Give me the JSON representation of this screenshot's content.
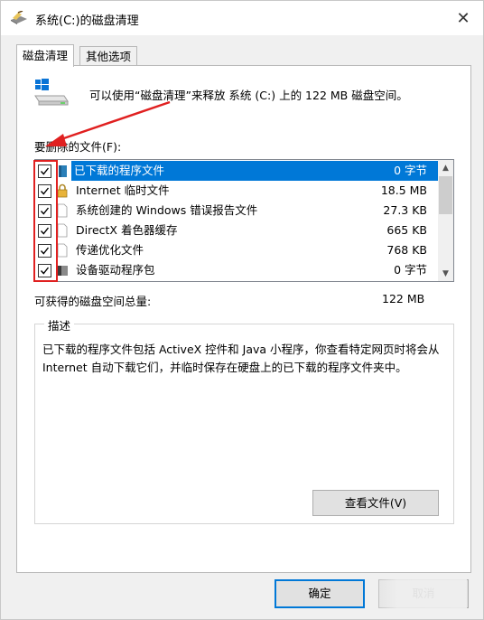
{
  "window": {
    "title": "系统(C:)的磁盘清理",
    "close": "✕"
  },
  "tabs": [
    {
      "label": "磁盘清理",
      "active": true
    },
    {
      "label": "其他选项",
      "active": false
    }
  ],
  "intro": "可以使用“磁盘清理”来释放 系统 (C:) 上的 122 MB 磁盘空间。",
  "files_label": "要删除的文件(F):",
  "files": [
    {
      "name": "已下载的程序文件",
      "size": "0 字节",
      "checked": true,
      "selected": true,
      "icon": "folder-icon"
    },
    {
      "name": "Internet 临时文件",
      "size": "18.5 MB",
      "checked": true,
      "selected": false,
      "icon": "lock-icon"
    },
    {
      "name": "系统创建的 Windows 错误报告文件",
      "size": "27.3 KB",
      "checked": true,
      "selected": false,
      "icon": "document-icon"
    },
    {
      "name": "DirectX 着色器缓存",
      "size": "665 KB",
      "checked": true,
      "selected": false,
      "icon": "document-icon"
    },
    {
      "name": "传递优化文件",
      "size": "768 KB",
      "checked": true,
      "selected": false,
      "icon": "document-icon"
    },
    {
      "name": "设备驱动程序包",
      "size": "0 字节",
      "checked": true,
      "selected": false,
      "icon": "driver-package-icon"
    }
  ],
  "total": {
    "label": "可获得的磁盘空间总量:",
    "value": "122 MB"
  },
  "description": {
    "title": "描述",
    "text": "已下载的程序文件包括 ActiveX 控件和 Java 小程序，你查看特定网页时将会从 Internet 自动下载它们，并临时保存在硬盘上的已下载的程序文件夹中。"
  },
  "buttons": {
    "view_files": "查看文件(V)",
    "ok": "确定",
    "cancel": "取消"
  },
  "colors": {
    "selection": "#0078d7",
    "annotation": "#e02020"
  }
}
